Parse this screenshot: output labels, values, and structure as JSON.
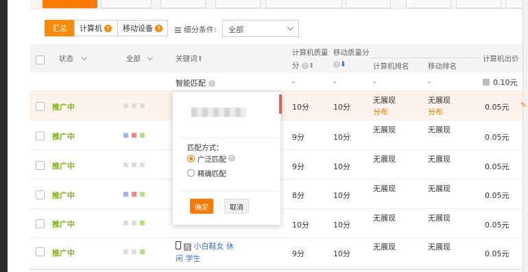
{
  "toolbar": {
    "segments": [
      {
        "label": "汇总",
        "active": true
      },
      {
        "label": "计算机",
        "active": false
      },
      {
        "label": "移动设备",
        "active": false
      }
    ],
    "help_icon": "?",
    "filter_label": "细分条件:",
    "filter_value": "全部"
  },
  "header": {
    "status": "状态",
    "all": "全部",
    "keyword": "关键词",
    "pc_quality_l1": "计算机质量",
    "pc_quality_l2": "分",
    "mobile_quality": "移动质量分",
    "pc_rank": "计算机排名",
    "mobile_rank": "移动排名",
    "pc_bid": "计算机出价"
  },
  "smart_row": {
    "keyword": "智能匹配",
    "pc_quality": "-",
    "mobile_quality": "-",
    "pc_rank": "-",
    "mobile_rank": "-",
    "bid": "0.10元"
  },
  "rows": [
    {
      "status": "推广中",
      "pc_quality": "10分",
      "mobile_quality": "10分",
      "pc_rank": "无展现",
      "pc_rank_sub": "分布",
      "mobile_rank": "无展现",
      "mobile_rank_sub": "分布",
      "bid": "0.05元"
    },
    {
      "status": "推广中",
      "pc_quality": "9分",
      "mobile_quality": "10分",
      "pc_rank": "无展现",
      "mobile_rank": "无展现",
      "bid": "0.05元"
    },
    {
      "status": "推广中",
      "pc_quality": "9分",
      "mobile_quality": "10分",
      "pc_rank": "无展现",
      "mobile_rank": "无展现",
      "bid": "0.05元"
    },
    {
      "status": "推广中",
      "pc_quality": "8分",
      "mobile_quality": "10分",
      "pc_rank": "无展现",
      "mobile_rank": "无展现",
      "bid": "0.05元"
    },
    {
      "status": "推广中",
      "pc_quality": "10分",
      "mobile_quality": "10分",
      "pc_rank": "无展现",
      "mobile_rank": "无展现",
      "bid": "0.05元"
    },
    {
      "status": "推广中",
      "keyword_tag": "左",
      "keyword_l1": "小白鞋女 休",
      "keyword_l2": "闲 学生",
      "pc_quality": "9分",
      "mobile_quality": "10分",
      "pc_rank": "无展现",
      "mobile_rank": "无展现",
      "bid": "0.05元"
    }
  ],
  "popup": {
    "match_label": "匹配方式：",
    "broad": "广泛匹配",
    "exact": "精确匹配",
    "ok": "确定",
    "cancel": "取消"
  },
  "colors": {
    "accent": "#ff7a00",
    "status_green": "#7cb305",
    "link_blue": "#3b6fc2"
  }
}
